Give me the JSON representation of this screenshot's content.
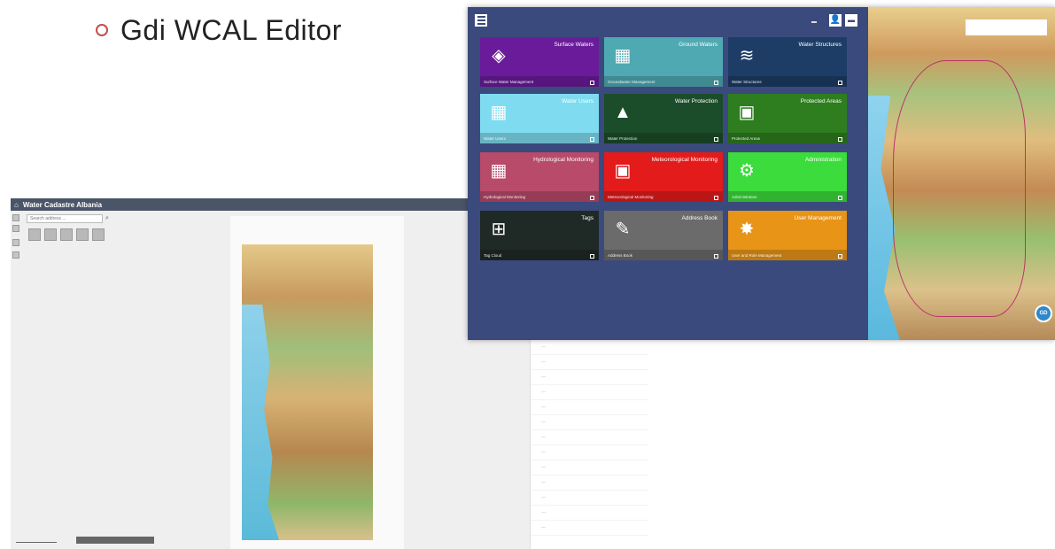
{
  "slide": {
    "title": "Gdi WCAL Editor"
  },
  "background_app": {
    "title": "Water Cadastre Albania",
    "search_placeholder": "Search address ...",
    "coord_readout": "",
    "layer_list": [
      "",
      "",
      "",
      "",
      "",
      "",
      "",
      "",
      "",
      "",
      "",
      "",
      ""
    ]
  },
  "foreground_app": {
    "tiles": [
      {
        "title": "Surface Waters",
        "sub": "Surface Water Management",
        "color": "#6a1b9a",
        "icon": "layers-icon"
      },
      {
        "title": "Ground Waters",
        "sub": "Groundwater Management",
        "color": "#4fa9b3",
        "icon": "map-icon"
      },
      {
        "title": "Water Structures",
        "sub": "Water Structures",
        "color": "#1d3c66",
        "icon": "waves-icon"
      },
      {
        "title": "Water Users",
        "sub": "Water Users",
        "color": "#7fdcf0",
        "icon": "map-icon"
      },
      {
        "title": "Water Protection",
        "sub": "Water Protection",
        "color": "#1b4d2a",
        "icon": "warning-icon"
      },
      {
        "title": "Protected Areas",
        "sub": "Protected Areas",
        "color": "#2e7d1f",
        "icon": "document-icon"
      },
      {
        "title": "Hydrological Monitoring",
        "sub": "Hydrological Monitoring",
        "color": "#b84a6a",
        "icon": "map-icon"
      },
      {
        "title": "Meteorological Monitoring",
        "sub": "Meteorological Monitoring",
        "color": "#e31b1b",
        "icon": "document-icon"
      },
      {
        "title": "Administration",
        "sub": "Administration",
        "color": "#3bdc3b",
        "icon": "settings-icon"
      },
      {
        "title": "Tags",
        "sub": "Tag Cloud",
        "color": "#1f2a26",
        "icon": "stamp-icon"
      },
      {
        "title": "Address Book",
        "sub": "Address Book",
        "color": "#6b6b6b",
        "icon": "edit-icon"
      },
      {
        "title": "User Management",
        "sub": "User and Role Management",
        "color": "#e89417",
        "icon": "gear-icon"
      }
    ],
    "map_badge": "GD"
  }
}
